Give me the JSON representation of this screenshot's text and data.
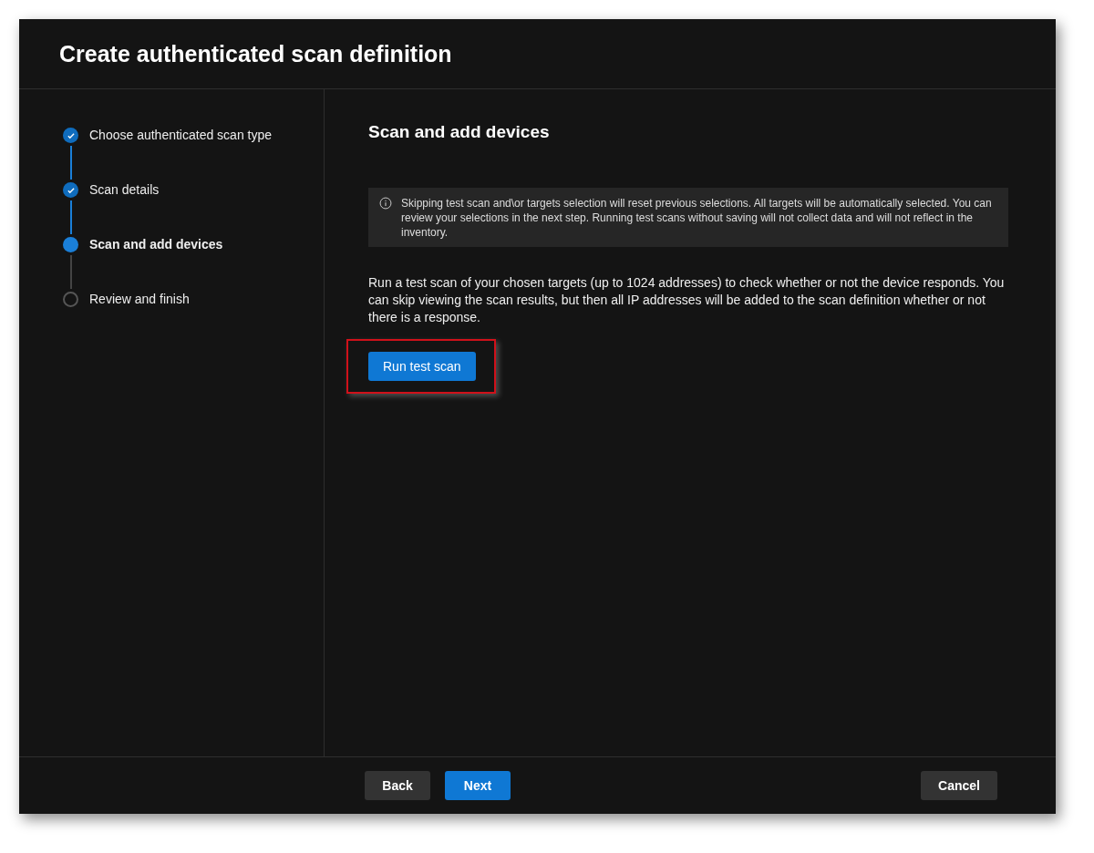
{
  "dialog": {
    "title": "Create authenticated scan definition"
  },
  "steps": [
    {
      "label": "Choose authenticated scan type",
      "kind": "done"
    },
    {
      "label": "Scan details",
      "kind": "done"
    },
    {
      "label": "Scan and add devices",
      "kind": "current"
    },
    {
      "label": "Review and finish",
      "kind": "pending"
    }
  ],
  "content": {
    "heading": "Scan and add devices",
    "info": "Skipping test scan and\\or targets selection will reset previous selections. All targets will be automatically selected. You can review your selections in the next step. Running test scans without saving will not collect data and will not reflect in the inventory.",
    "description": "Run a test scan of your chosen targets (up to 1024 addresses) to check whether or not the device responds. You can skip viewing the scan results, but then all IP addresses will be added to the scan definition whether or not there is a response.",
    "run_button": {
      "label": "Run test scan",
      "highlighted": true
    }
  },
  "footer": {
    "back": "Back",
    "next": "Next",
    "cancel": "Cancel"
  }
}
